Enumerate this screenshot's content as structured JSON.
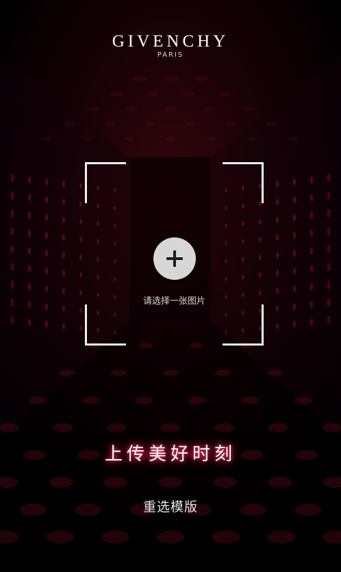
{
  "brand": {
    "name": "GIVENCHY",
    "sub": "PARIS"
  },
  "upload": {
    "hint": "请选择一张图片",
    "icon": "plus-icon"
  },
  "title": "上传美好时刻",
  "actions": {
    "reselect": "重选模版"
  },
  "colors": {
    "background": "#000000",
    "tunnel_red": "#b10f2e",
    "glow_pink": "#ff4a75",
    "button_gray": "#d7d7d7"
  }
}
